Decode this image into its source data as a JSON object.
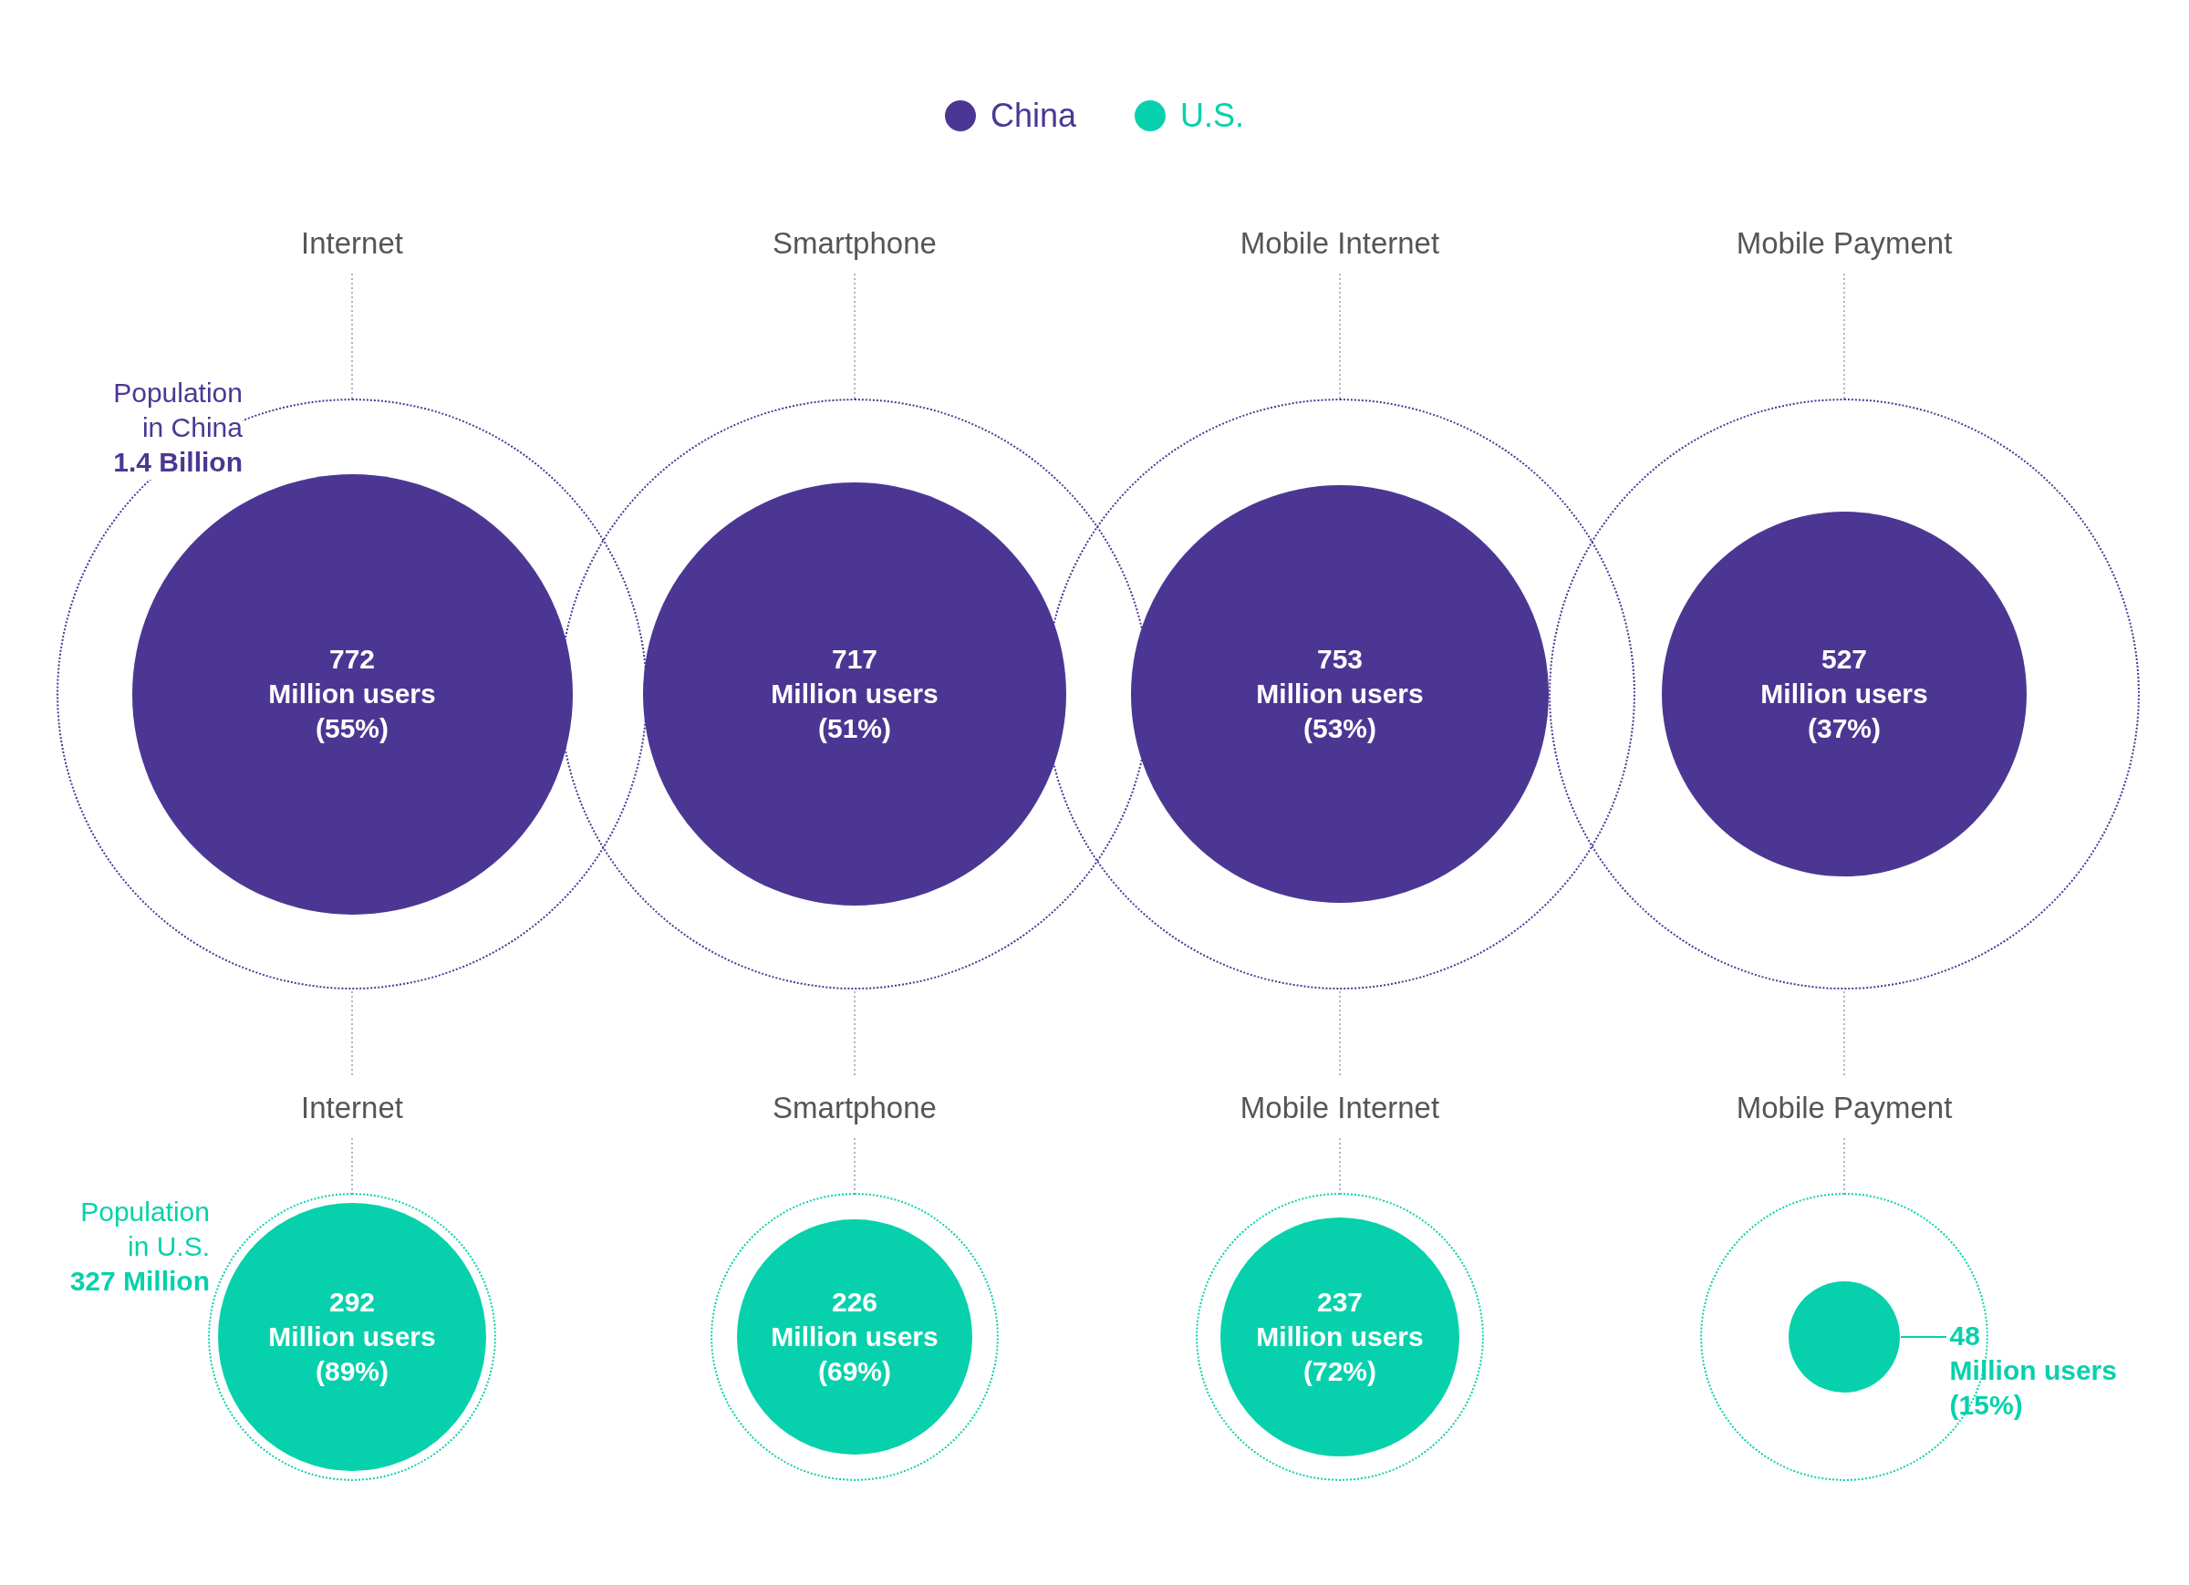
{
  "legend": [
    {
      "label": "China",
      "color": "#4b3793"
    },
    {
      "label": "U.S.",
      "color": "#07d1ac"
    }
  ],
  "china": {
    "population_label": "Population in China",
    "population_value": "1.4 Billion",
    "color": "#4b3793",
    "items": [
      {
        "kind": "inside",
        "category": "Internet",
        "value": "772",
        "unit": "Million users",
        "share": "(55%)"
      },
      {
        "kind": "inside",
        "category": "Smartphone",
        "value": "717",
        "unit": "Million users",
        "share": "(51%)"
      },
      {
        "kind": "inside",
        "category": "Mobile Internet",
        "value": "753",
        "unit": "Million users",
        "share": "(53%)"
      },
      {
        "kind": "inside",
        "category": "Mobile Payment",
        "value": "527",
        "unit": "Million users",
        "share": "(37%)"
      }
    ]
  },
  "us": {
    "population_label": "Population in U.S.",
    "population_value": "327 Million",
    "color": "#07d1ac",
    "items": [
      {
        "kind": "inside",
        "category": "Internet",
        "value": "292",
        "unit": "Million users",
        "share": "(89%)"
      },
      {
        "kind": "inside",
        "category": "Smartphone",
        "value": "226",
        "unit": "Million users",
        "share": "(69%)"
      },
      {
        "kind": "inside",
        "category": "Mobile Internet",
        "value": "237",
        "unit": "Million users",
        "share": "(72%)"
      },
      {
        "kind": "outside",
        "category": "Mobile Payment",
        "value": "48",
        "unit": "Million users",
        "share": "(15%)"
      }
    ]
  }
}
